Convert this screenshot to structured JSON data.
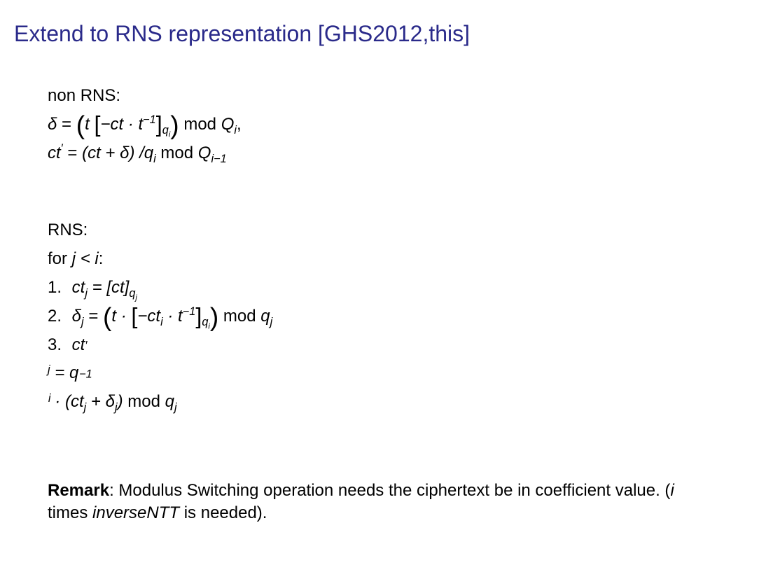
{
  "title": "Extend to RNS representation [GHS2012,this]",
  "nonRnsLabel": "non RNS:",
  "eq1_a": "δ",
  "eq1_b": "=",
  "eq1_c": "t",
  "eq1_d": "−ct · t",
  "eq1_e": "−1",
  "eq1_f": "q",
  "eq1_g": "i",
  "eq1_h": "mod",
  "eq1_i": "Q",
  "eq1_j": "i",
  "eq1_k": ",",
  "eq2_a": "ct",
  "eq2_b": "′",
  "eq2_c": "=",
  "eq2_d": "(ct + δ) /q",
  "eq2_e": "i",
  "eq2_f": "mod",
  "eq2_g": "Q",
  "eq2_h": "i−1",
  "rnsLabel": "RNS:",
  "forLabel_a": "for",
  "forLabel_b": "j < i",
  "forLabel_c": ":",
  "s1_n": "1.",
  "s1_a": "ct",
  "s1_b": "j",
  "s1_c": "= [ct]",
  "s1_d": "q",
  "s1_e": "j",
  "s2_n": "2.",
  "s2_a": "δ",
  "s2_b": "j",
  "s2_c": "=",
  "s2_d": "t ·",
  "s2_e": "−ct",
  "s2_f": "i",
  "s2_g": "· t",
  "s2_h": "−1",
  "s2_i": "q",
  "s2_j": "i",
  "s2_k": "mod",
  "s2_l": "q",
  "s2_m": "j",
  "s3_n": "3.",
  "s3_a": "ct",
  "s3_b": "′",
  "s3_c": "j",
  "s3_d": "= q",
  "s3_e": "−1",
  "s3_f": "i",
  "s3_g": "· (ct",
  "s3_h": "j",
  "s3_i": "+ δ",
  "s3_j": "j",
  "s3_k": ")",
  "s3_l": "mod",
  "s3_m": "q",
  "s3_o": "j",
  "remark_bold": "Remark",
  "remark_a": ": Modulus Switching operation needs the ciphertext be in coefficient value. (",
  "remark_b": "i",
  "remark_c": " times ",
  "remark_d": "inverseNTT",
  "remark_e": " is needed)."
}
